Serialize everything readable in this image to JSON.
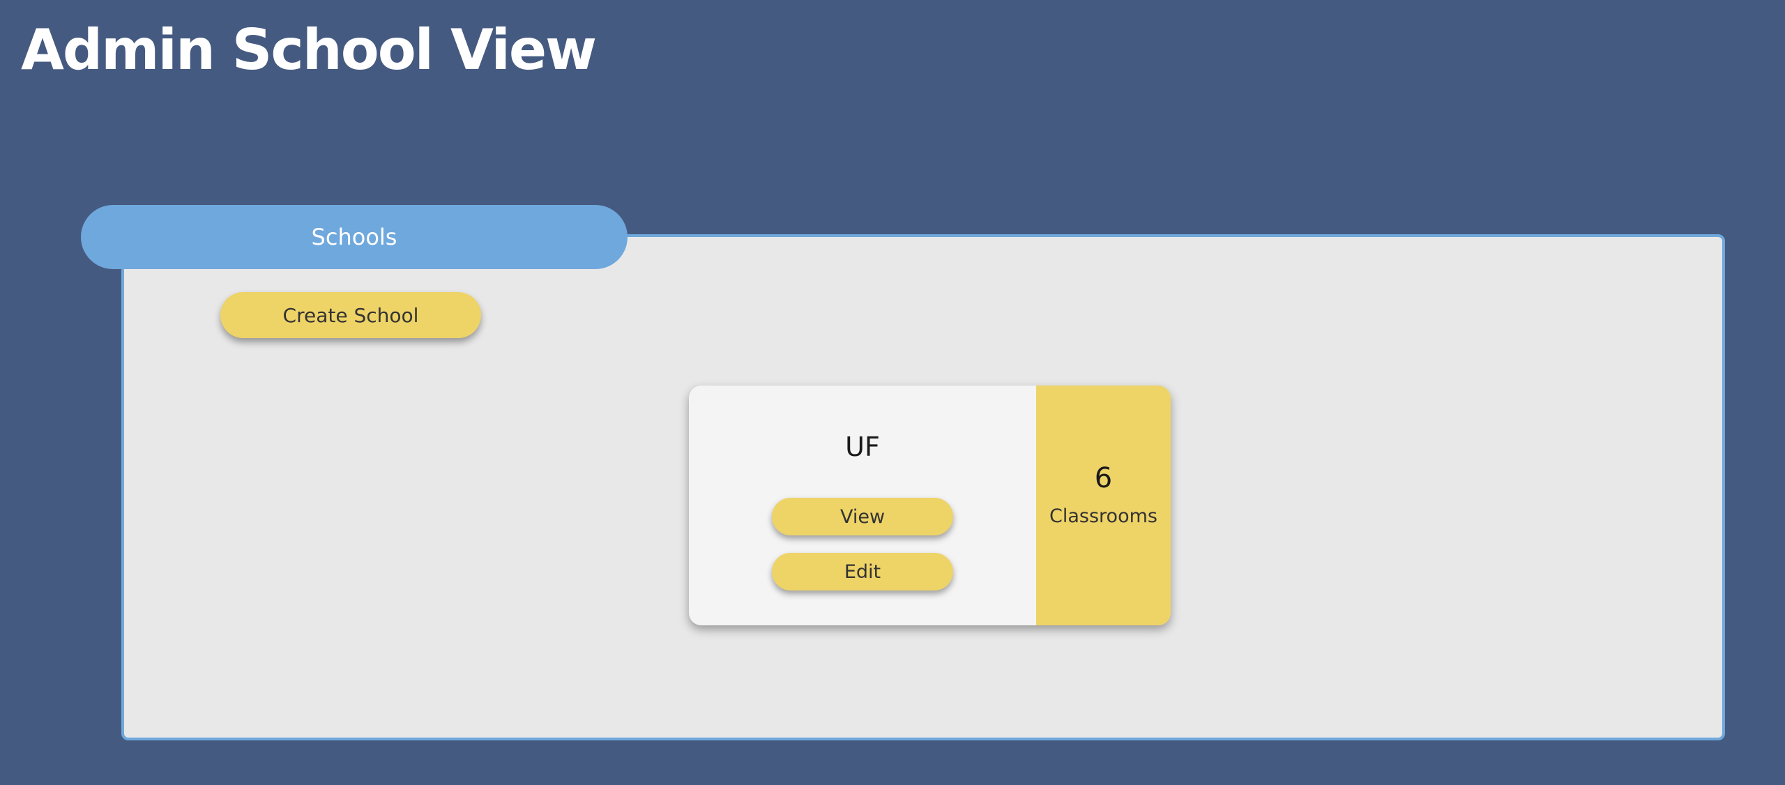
{
  "page": {
    "title": "Admin School View"
  },
  "schools_panel": {
    "tab_label": "Schools",
    "create_button_label": "Create School"
  },
  "schools": [
    {
      "name": "UF",
      "view_label": "View",
      "edit_label": "Edit",
      "classroom_count": "6",
      "classroom_label": "Classrooms"
    }
  ],
  "colors": {
    "background": "#455a80",
    "panel_background": "#e8e8e8",
    "accent_blue": "#6fa8dc",
    "accent_yellow": "#eed367",
    "card_background": "#f4f4f4"
  }
}
